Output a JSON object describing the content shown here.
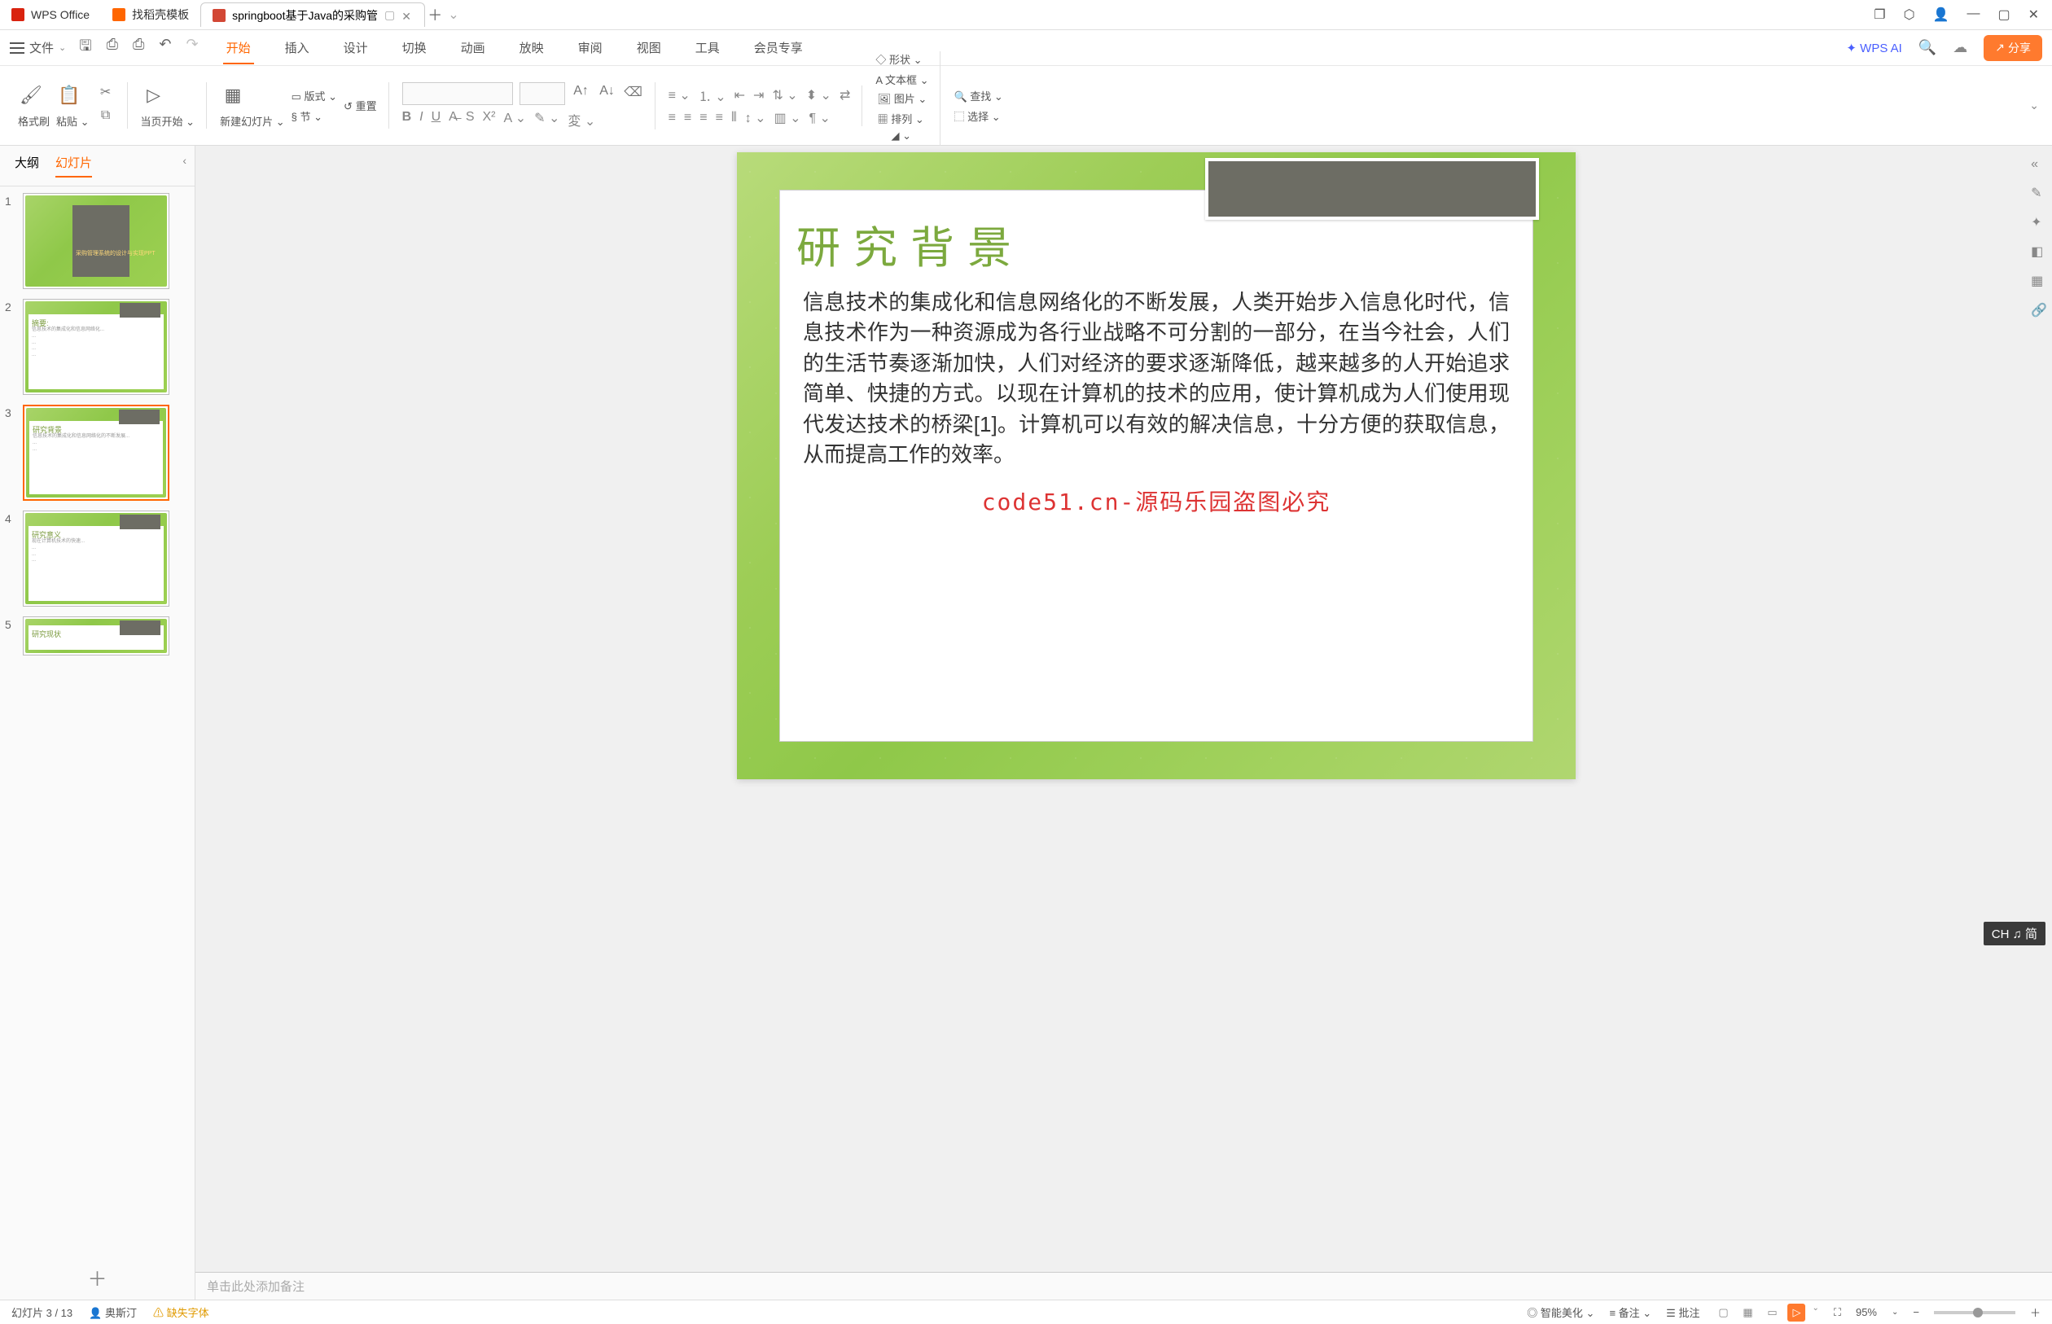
{
  "titlebar": {
    "tabs": [
      {
        "icon": "wps",
        "label": "WPS Office"
      },
      {
        "icon": "dy",
        "label": "找稻壳模板"
      },
      {
        "icon": "ppt",
        "label": "springboot基于Java的采购管"
      }
    ],
    "close": "✕",
    "add": "＋"
  },
  "menubar": {
    "file": "文件",
    "tabs": [
      "开始",
      "插入",
      "设计",
      "切换",
      "动画",
      "放映",
      "审阅",
      "视图",
      "工具",
      "会员专享"
    ],
    "ai": "WPS AI",
    "share": "分享"
  },
  "ribbon": {
    "format_brush": "格式刷",
    "paste": "粘贴",
    "from_page": "当页开始",
    "new_slide": "新建幻灯片",
    "layout": "版式",
    "section": "节",
    "reset": "重置",
    "shape": "形状",
    "textbox": "文本框",
    "picture": "图片",
    "arrange": "排列",
    "find": "查找",
    "select": "选择"
  },
  "outline": {
    "tab1": "大纲",
    "tab2": "幻灯片"
  },
  "thumbs": [
    {
      "num": "1",
      "title": "采购管理系统的设计与实现PPT"
    },
    {
      "num": "2",
      "title": "摘要:"
    },
    {
      "num": "3",
      "title": "研究背景"
    },
    {
      "num": "4",
      "title": "研究意义"
    },
    {
      "num": "5",
      "title": "研究现状"
    }
  ],
  "slide": {
    "title": "研究背景",
    "body": "信息技术的集成化和信息网络化的不断发展，人类开始步入信息化时代，信息技术作为一种资源成为各行业战略不可分割的一部分，在当今社会，人们的生活节奏逐渐加快，人们对经济的要求逐渐降低，越来越多的人开始追求简单、快捷的方式。以现在计算机的技术的应用，使计算机成为人们使用现代发达技术的桥梁[1]。计算机可以有效的解决信息，十分方便的获取信息，从而提高工作的效率。",
    "watermark": "code51.cn-源码乐园盗图必究"
  },
  "notes": "单击此处添加备注",
  "status": {
    "page": "幻灯片 3 / 13",
    "author": "奥斯汀",
    "warning": "缺失字体",
    "beautify": "智能美化",
    "notes": "备注",
    "comment": "批注",
    "zoom": "95%"
  },
  "ime": "CH ♫ 简"
}
